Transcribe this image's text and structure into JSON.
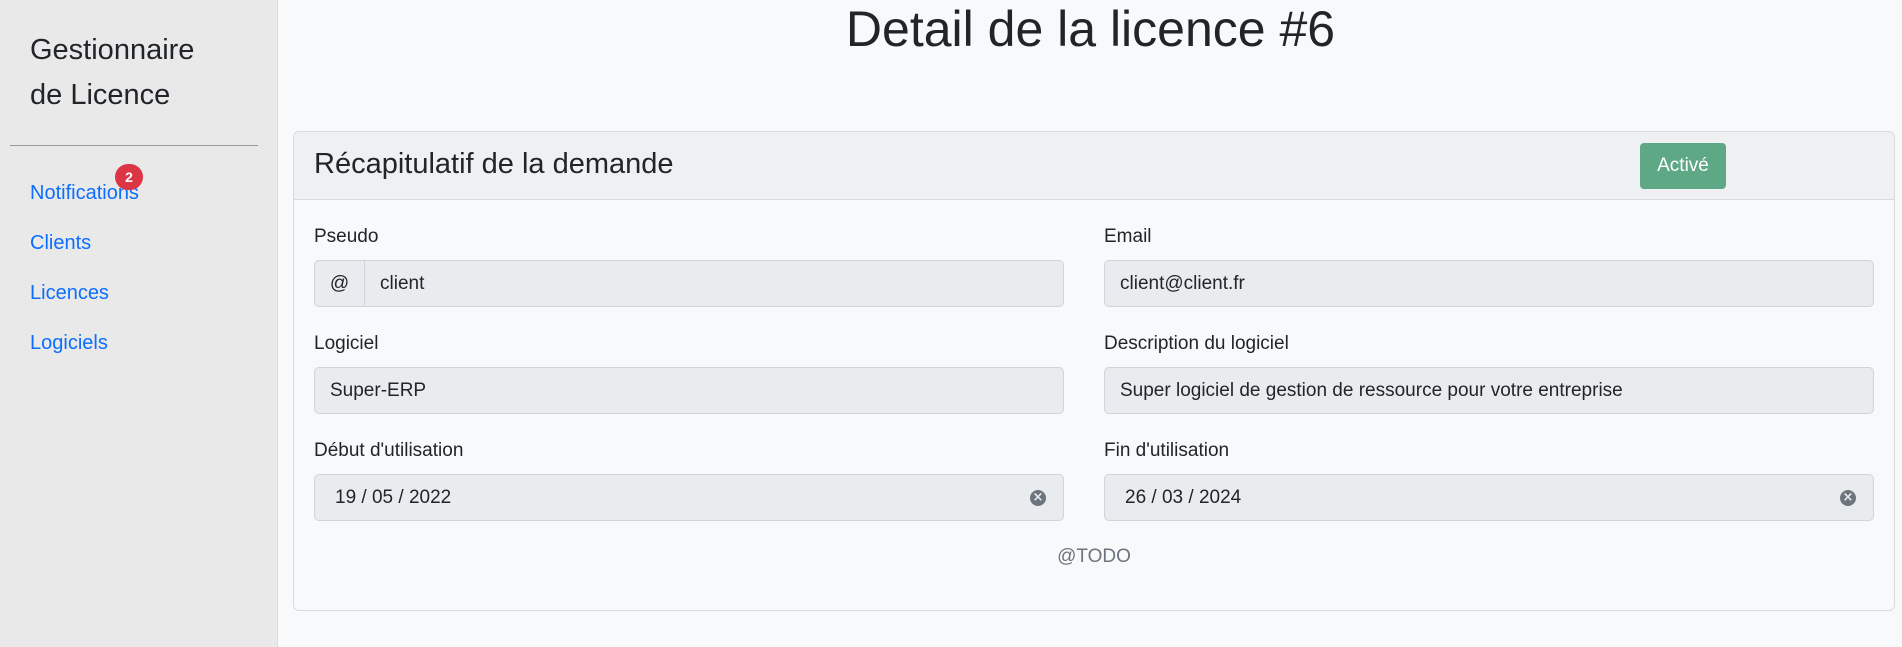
{
  "sidebar": {
    "brand_line1": "Gestionnaire",
    "brand_line2": "de Licence",
    "items": [
      {
        "label": "Notifications",
        "badge": "2"
      },
      {
        "label": "Clients"
      },
      {
        "label": "Licences"
      },
      {
        "label": "Logiciels"
      }
    ]
  },
  "main": {
    "title": "Detail de la licence #6",
    "card": {
      "title": "Récapitulatif de la demande",
      "status_label": "Activé",
      "fields": {
        "pseudo_label": "Pseudo",
        "pseudo_prefix": "@",
        "pseudo_value": "client",
        "email_label": "Email",
        "email_value": "client@client.fr",
        "logiciel_label": "Logiciel",
        "logiciel_value": "Super-ERP",
        "description_label": "Description du logiciel",
        "description_value": "Super logiciel de gestion de ressource pour votre entreprise",
        "debut_label": "Début d'utilisation",
        "debut_value": "19 / 05 / 2022",
        "fin_label": "Fin d'utilisation",
        "fin_value": "26 / 03 / 2024"
      },
      "todo": "@TODO"
    }
  },
  "colors": {
    "link": "#0d6efd",
    "badge": "#dc3545",
    "status": "#5fa886",
    "sidebar_bg": "#e9e9e9",
    "field_bg": "#e9ecef"
  },
  "icons": [
    "clear-icon"
  ]
}
